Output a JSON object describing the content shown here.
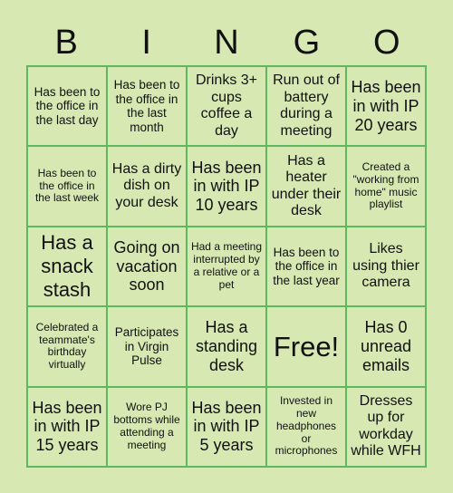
{
  "title_letters": [
    "B",
    "I",
    "N",
    "G",
    "O"
  ],
  "colors": {
    "background": "#d7e8b2",
    "grid_lines": "#5fb85f",
    "text": "#111111"
  },
  "board": [
    [
      "Has been to the office in the last day",
      "Has been to the office in the last month",
      "Drinks 3+ cups coffee a day",
      "Run out of battery during a meeting",
      "Has been in with IP 20 years"
    ],
    [
      "Has been to the office in the last week",
      "Has a dirty dish on your desk",
      "Has been in with IP 10 years",
      "Has a heater under their desk",
      "Created a \"working from home\" music playlist"
    ],
    [
      "Has a snack stash",
      "Going on vacation soon",
      "Had a meeting interrupted by a relative or a pet",
      "Has been to the office in the last year",
      "Likes using thier camera"
    ],
    [
      "Celebrated a teammate's birthday virtually",
      "Participates in Virgin Pulse",
      "Has a standing desk",
      "Free!",
      "Has 0 unread emails"
    ],
    [
      "Has been in with IP 15 years",
      "Wore PJ bottoms while attending a meeting",
      "Has been in with IP 5 years",
      "Invested in new headphones or microphones",
      "Dresses up for workday while WFH"
    ]
  ]
}
